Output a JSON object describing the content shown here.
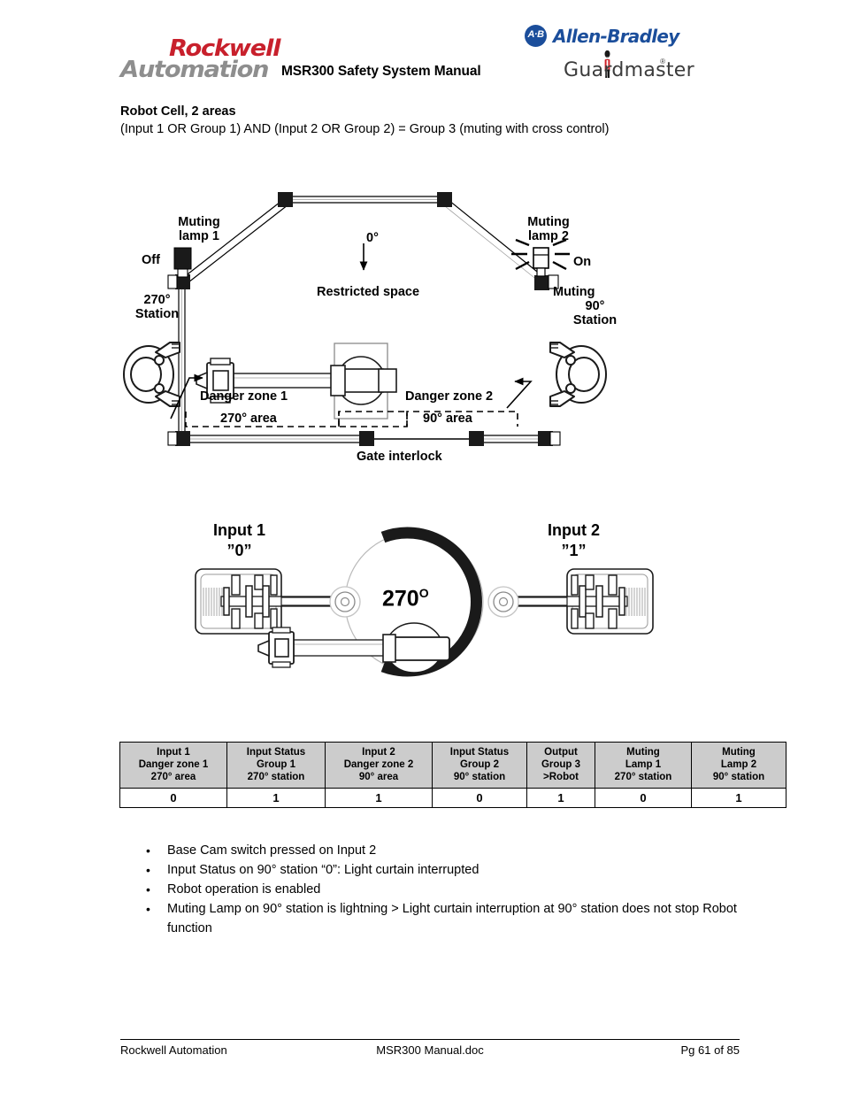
{
  "header": {
    "rockwell_top": "Rockwell",
    "rockwell_bottom": "Automation",
    "title": "MSR300 Safety System Manual",
    "ab_badge": "A·B",
    "ab_name": "Allen-Bradley",
    "guardmaster": "Guardmaster",
    "guardmaster_reg": "®"
  },
  "section": {
    "title": "Robot Cell, 2 areas",
    "formula": "(Input 1 OR Group 1) AND (Input 2 OR Group 2) = Group 3 (muting with cross control)"
  },
  "diagram_top": {
    "muting_lamp_1": "Muting\nlamp 1",
    "muting_lamp_1_line1": "Muting",
    "muting_lamp_1_line2": "lamp 1",
    "off_label": "Off",
    "station_270_line1": "270°",
    "station_270_line2": "Station",
    "angle_0": "0°",
    "restricted_space": "Restricted space",
    "muting_lamp_2_line1": "Muting",
    "muting_lamp_2_line2": "lamp 2",
    "on_label": "On",
    "muting_90_line1": "Muting",
    "muting_90_line2": "90°",
    "muting_90_line3": "Station",
    "danger_zone_1": "Danger zone 1",
    "area_270": "270° area",
    "danger_zone_2": "Danger zone 2",
    "area_90": "90° area",
    "gate_interlock": "Gate interlock"
  },
  "diagram_bottom": {
    "input_1_label": "Input 1",
    "input_1_value": "”0”",
    "input_2_label": "Input 2",
    "input_2_value": "”1”",
    "center_angle": "270",
    "center_degree": "O"
  },
  "table": {
    "headers": [
      {
        "l1": "Input 1",
        "l2": "Danger zone 1",
        "l3": "270° area"
      },
      {
        "l1": "Input Status",
        "l2": "Group 1",
        "l3": "270° station"
      },
      {
        "l1": "Input 2",
        "l2": "Danger zone 2",
        "l3": "90° area"
      },
      {
        "l1": "Input Status",
        "l2": "Group 2",
        "l3": "90° station"
      },
      {
        "l1": "Output",
        "l2": "Group 3",
        "l3": ">Robot"
      },
      {
        "l1": "Muting",
        "l2": "Lamp 1",
        "l3": "270° station"
      },
      {
        "l1": "Muting",
        "l2": "Lamp 2",
        "l3": "90° station"
      }
    ],
    "values": [
      "0",
      "1",
      "1",
      "0",
      "1",
      "0",
      "1"
    ]
  },
  "bullets": [
    "Base Cam switch pressed on Input 2",
    "Input Status on 90° station “0”: Light curtain interrupted",
    "Robot operation is enabled",
    "Muting Lamp on 90° station is lightning > Light curtain interruption at 90° station does not stop Robot function"
  ],
  "footer": {
    "left": "Rockwell Automation",
    "middle": "MSR300 Manual.doc",
    "right": "Pg 61 of 85"
  },
  "colors": {
    "rockwell_red": "#c8202c",
    "rockwell_gray": "#8e8e8e",
    "ab_blue": "#1b4e9b",
    "table_header_bg": "#cccccc",
    "ink": "#000000"
  }
}
